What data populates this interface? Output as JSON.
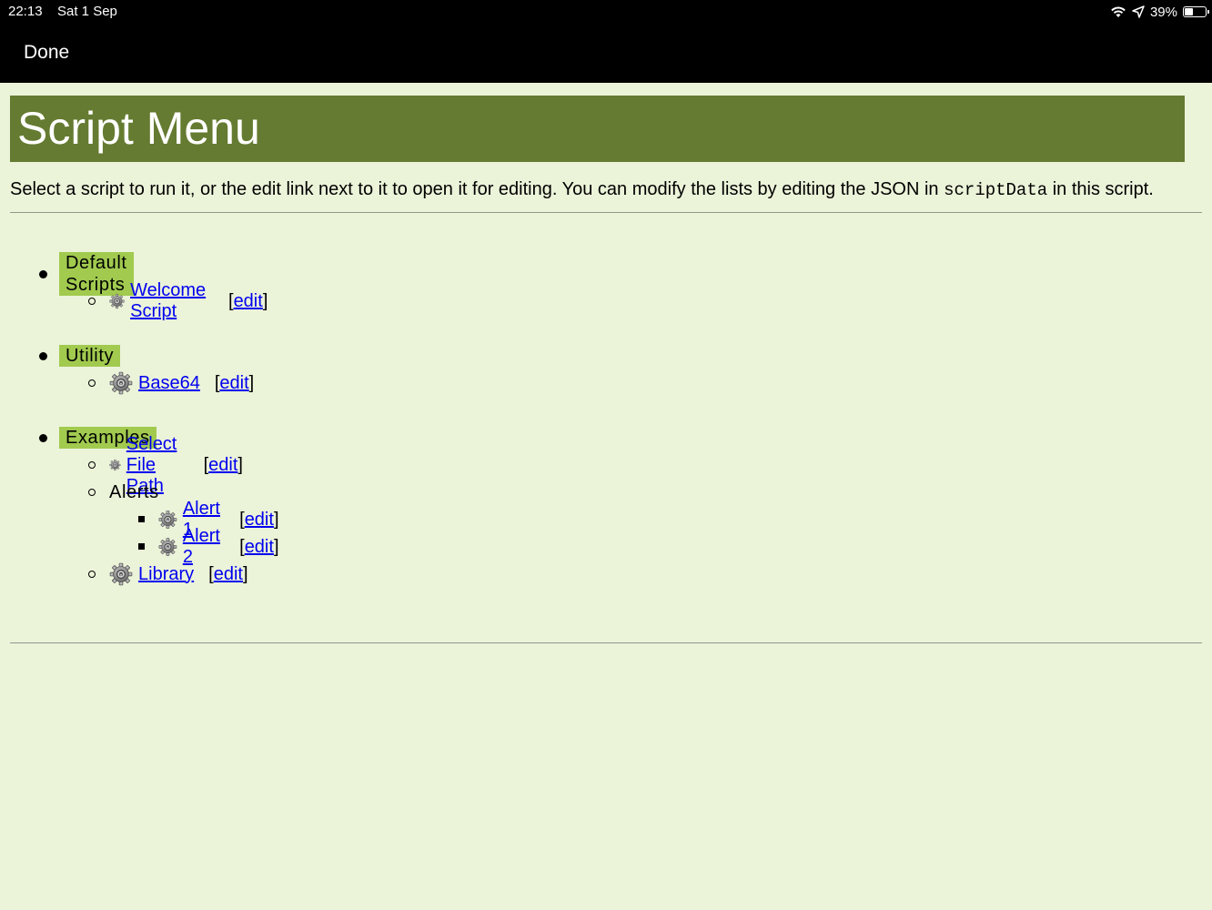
{
  "status_bar": {
    "time": "22:13",
    "date": "Sat 1 Sep",
    "battery_text": "39%",
    "battery_level": 0.39
  },
  "nav": {
    "done_label": "Done"
  },
  "page": {
    "title": "Script Menu",
    "intro_before": "Select a script to run it, or the edit link next to it to open it for editing. You can modify the lists by editing the JSON in ",
    "intro_code": "scriptData",
    "intro_after": " in this script."
  },
  "groups": [
    {
      "label": "Default Scripts",
      "items": [
        {
          "name": "Welcome Script",
          "edit": "edit"
        }
      ]
    },
    {
      "label": "Utility",
      "items": [
        {
          "name": "Base64",
          "edit": "edit"
        }
      ]
    },
    {
      "label": "Examples",
      "items": [
        {
          "name": "Select File Path",
          "edit": "edit"
        },
        {
          "label": "Alerts",
          "items": [
            {
              "name": "Alert 1",
              "edit": "edit"
            },
            {
              "name": "Alert 2",
              "edit": "edit"
            }
          ]
        },
        {
          "name": "Library",
          "edit": "edit"
        }
      ]
    }
  ],
  "colors": {
    "background": "#ebf3d9",
    "header": "#657b31",
    "group_highlight": "#a1ca4f",
    "link": "#0000ee"
  },
  "icons": {
    "script_icon": "gear-icon"
  }
}
